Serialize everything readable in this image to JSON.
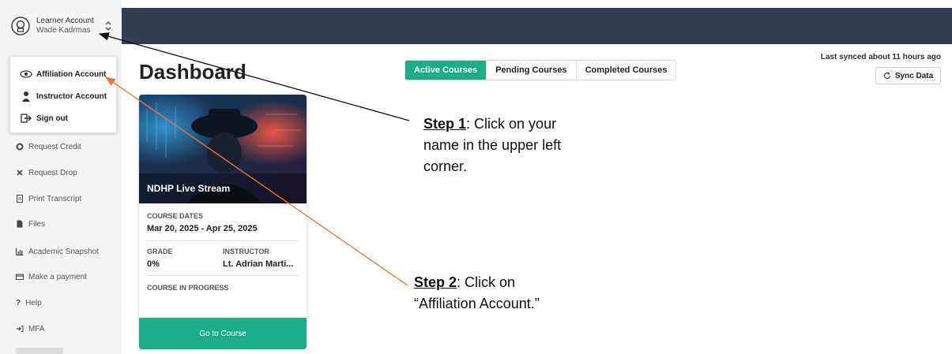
{
  "account": {
    "role": "Learner Account",
    "name": "Wade Kadrmas"
  },
  "dropdown": {
    "items": [
      {
        "label": "Affiliation Account",
        "icon": "affiliation-icon"
      },
      {
        "label": "Instructor Account",
        "icon": "instructor-icon"
      },
      {
        "label": "Sign out",
        "icon": "sign-out-icon"
      }
    ]
  },
  "sidebar": {
    "items": [
      {
        "label": "Request Credit",
        "icon": "circle-icon"
      },
      {
        "label": "Request Drop",
        "icon": "x-icon"
      },
      {
        "label": "Print Transcript",
        "icon": "document-icon"
      },
      {
        "label": "Files",
        "icon": "file-icon"
      },
      {
        "label": "Academic Snapshot",
        "icon": "chart-icon"
      },
      {
        "label": "Make a payment",
        "icon": "card-icon"
      },
      {
        "label": "Help",
        "icon": "question-icon"
      },
      {
        "label": "MFA",
        "icon": "key-icon"
      }
    ]
  },
  "main": {
    "title": "Dashboard",
    "tabs": [
      "Active Courses",
      "Pending Courses",
      "Completed Courses"
    ],
    "active_tab": "Active Courses",
    "synced_text": "Last synced about 11 hours ago",
    "sync_button": "Sync Data"
  },
  "course": {
    "image_title": "NDHP Live Stream",
    "dates_label": "COURSE DATES",
    "dates_value": "Mar 20, 2025 - Apr 25, 2025",
    "grade_label": "GRADE",
    "grade_value": "0%",
    "instructor_label": "INSTRUCTOR",
    "instructor_value": "Lt. Adrian Marti...",
    "status": "COURSE IN PROGRESS",
    "button": "Go to Course"
  },
  "annotations": {
    "step1_bold": "Step 1",
    "step1_text": ": Click on your name in the upper left corner.",
    "step2_bold": "Step 2",
    "step2_text": ": Click on “Affiliation Account.”"
  },
  "colors": {
    "accent": "#1aad87",
    "topbar": "#333f4f",
    "sidebar": "#f3f4f6",
    "arrow_step2": "#e07b39"
  }
}
